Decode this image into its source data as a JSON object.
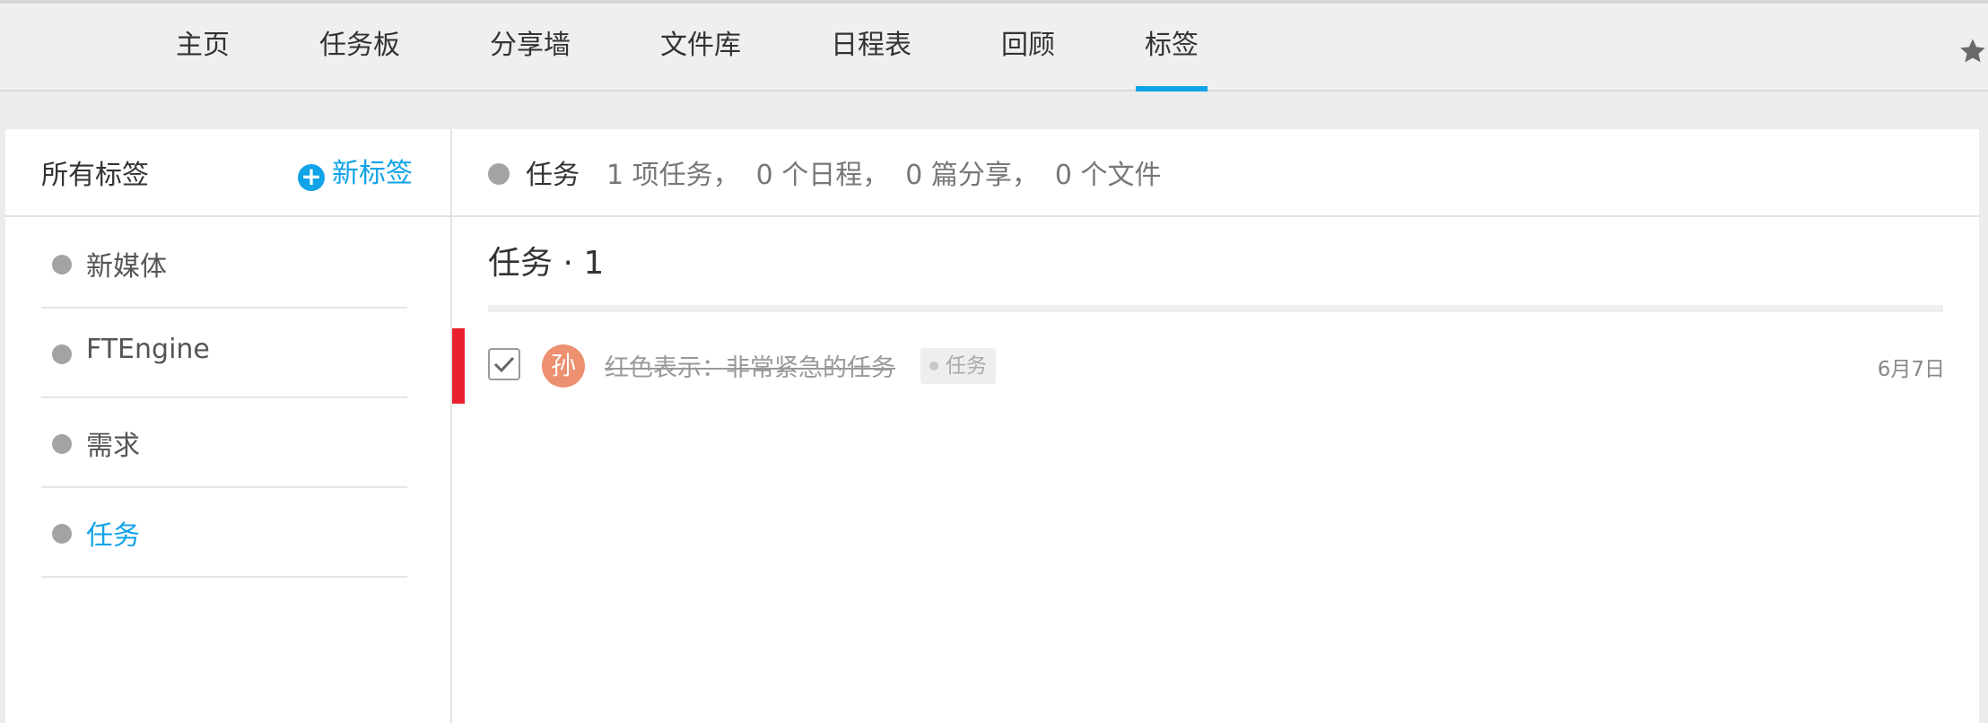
{
  "nav": {
    "items": [
      {
        "label": "主页"
      },
      {
        "label": "任务板"
      },
      {
        "label": "分享墙"
      },
      {
        "label": "文件库"
      },
      {
        "label": "日程表"
      },
      {
        "label": "回顾"
      },
      {
        "label": "标签"
      }
    ],
    "active": "标签"
  },
  "sidebar": {
    "title": "所有标签",
    "new_tag_label": "新标签",
    "tags": [
      {
        "label": "新媒体"
      },
      {
        "label": "FTEngine"
      },
      {
        "label": "需求"
      },
      {
        "label": "任务"
      }
    ],
    "active_tag": "任务"
  },
  "main": {
    "tag_name": "任务",
    "stats": [
      "1 项任务，",
      "0 个日程，",
      "0 篇分享，",
      "0 个文件"
    ],
    "section_title": "任务 · 1",
    "tasks": [
      {
        "title": "红色表示：非常紧急的任务",
        "assignee_initial": "孙",
        "tag": "任务",
        "date": "6月7日",
        "completed": true,
        "priority_color": "#e81f2d"
      }
    ]
  },
  "colors": {
    "accent": "#10a3e8",
    "priority_urgent": "#e81f2d",
    "avatar": "#ec9070",
    "tag_dot": "#a3a3a3"
  },
  "icons": [
    "star-icon",
    "plus-icon",
    "check-icon"
  ]
}
